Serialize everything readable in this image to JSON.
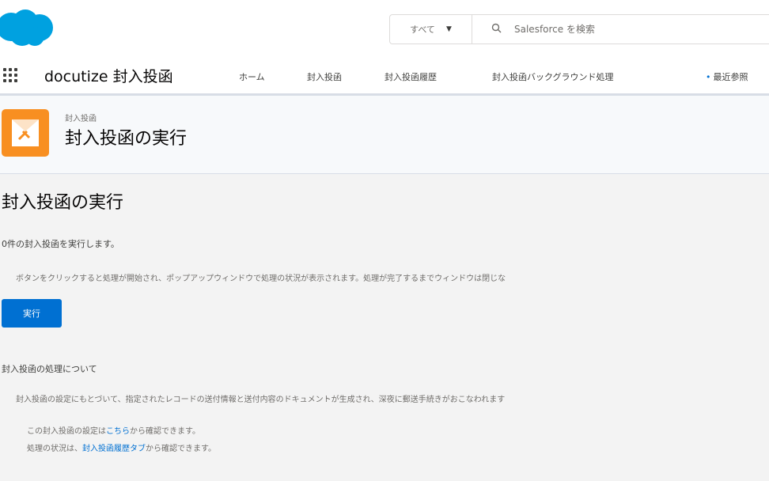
{
  "header": {
    "search_scope": "すべて",
    "search_placeholder": "Salesforce を検索"
  },
  "nav": {
    "app_name": "docutize 封入投函",
    "items": [
      {
        "label": "ホーム"
      },
      {
        "label": "封入投函"
      },
      {
        "label": "封入投函履歴"
      },
      {
        "label": "封入投函バックグラウンド処理"
      },
      {
        "label": "最近参照"
      }
    ]
  },
  "page_header": {
    "object_label": "封入投函",
    "title": "封入投函の実行"
  },
  "content": {
    "heading": "封入投函の実行",
    "count_text": "0件の封入投函を実行します。",
    "instruction": "ボタンをクリックすると処理が開始され、ポップアップウィンドウで処理の状況が表示されます。処理が完了するまでウィンドウは閉じな",
    "run_button": "実行",
    "about_heading": "封入投函の処理について",
    "about_text": "封入投函の設定にもとづいて、指定されたレコードの送付情報と送付内容のドキュメントが生成され、深夜に郵送手続きがおこなわれます",
    "settings_prefix": "この封入投函の設定は",
    "settings_link": "こちら",
    "settings_suffix": "から確認できます。",
    "status_prefix": "処理の状況は、",
    "status_link": "封入投函履歴タブ",
    "status_suffix": "から確認できます。"
  },
  "colors": {
    "brand_blue": "#0070d2",
    "salesforce_cloud": "#00a1e0",
    "object_icon": "#f88f21"
  }
}
